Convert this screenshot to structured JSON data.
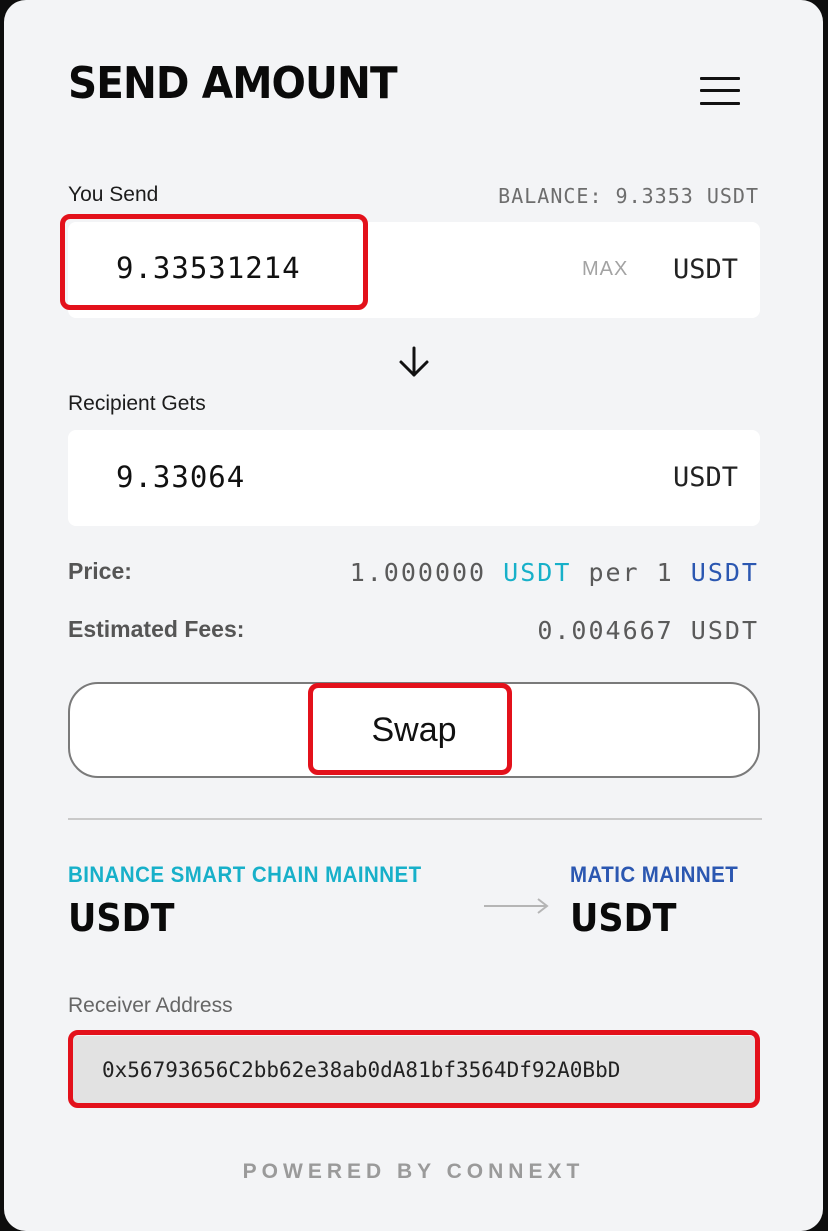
{
  "header": {
    "title": "SEND AMOUNT",
    "menu_icon": "hamburger-menu-icon"
  },
  "send": {
    "label": "You Send",
    "balance": "BALANCE: 9.3353 USDT",
    "amount": "9.33531214",
    "max_label": "MAX",
    "unit": "USDT"
  },
  "receive": {
    "label": "Recipient Gets",
    "amount": "9.33064",
    "unit": "USDT"
  },
  "details": {
    "price_label": "Price:",
    "price_value": "1.000000",
    "price_from_unit": "USDT",
    "price_per": "per 1",
    "price_to_unit": "USDT",
    "fees_label": "Estimated Fees:",
    "fees_value": "0.004667 USDT"
  },
  "swap": {
    "label": "Swap"
  },
  "route": {
    "from_network": "BINANCE SMART CHAIN MAINNET",
    "from_token": "USDT",
    "to_network": "MATIC MAINNET",
    "to_token": "USDT",
    "arrow_icon": "arrow-right-icon"
  },
  "receiver": {
    "label": "Receiver Address",
    "address": "0x56793656C2bb62e38ab0dA81bf3564Df92A0BbD"
  },
  "footer": {
    "powered_by": "POWERED BY CONNEXT"
  },
  "colors": {
    "highlight": "#e3111b",
    "cyan": "#17b0c9",
    "blue": "#2b57b1",
    "card_bg": "#f3f4f6"
  }
}
